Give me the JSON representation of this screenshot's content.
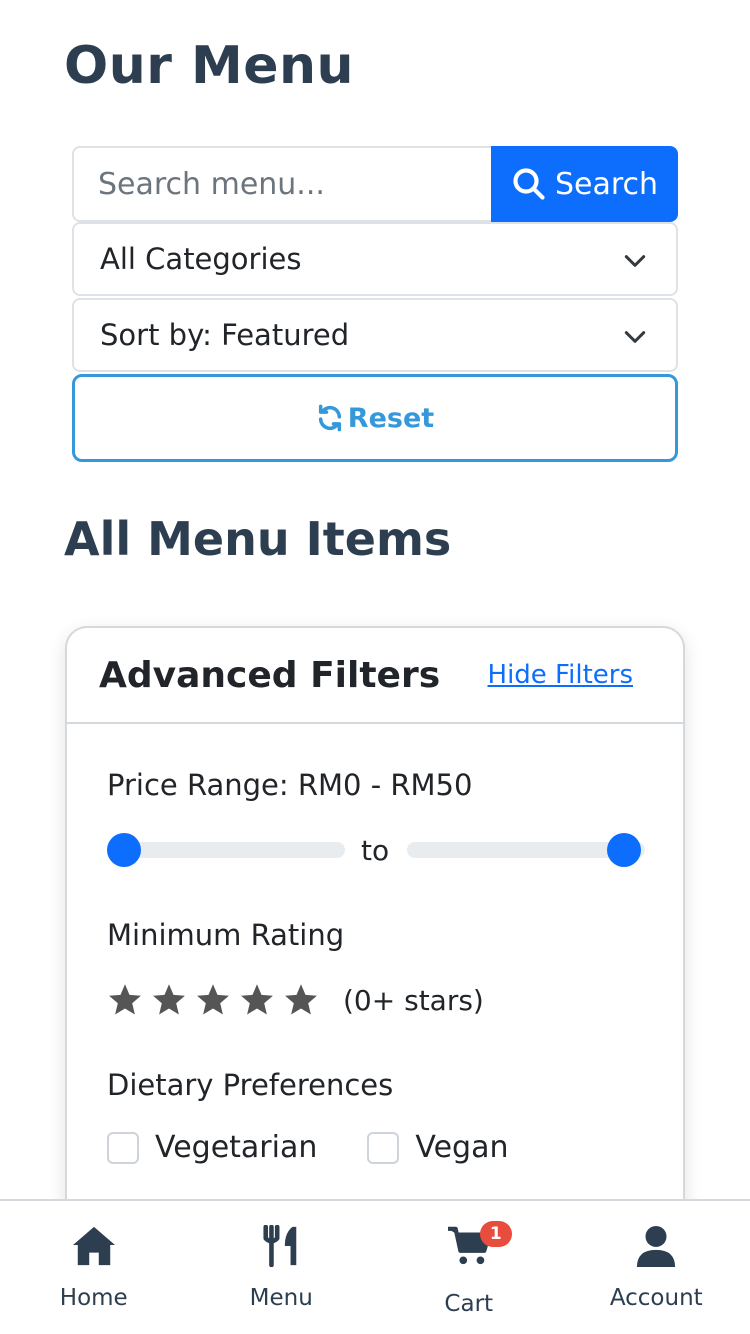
{
  "header": {
    "title": "Our Menu"
  },
  "search": {
    "placeholder": "Search menu...",
    "button_label": "Search"
  },
  "filters_bar": {
    "category_value": "All Categories",
    "sort_value": "Sort by: Featured",
    "reset_label": "Reset"
  },
  "section": {
    "title": "All Menu Items"
  },
  "advanced_filters": {
    "title": "Advanced Filters",
    "hide_label": "Hide Filters",
    "price_label": "Price Range: RM0 - RM50",
    "price_min": 0,
    "price_max": 50,
    "to_label": "to",
    "rating_label": "Minimum Rating",
    "rating_text": "(0+ stars)",
    "rating_value": 0,
    "dietary_label": "Dietary Preferences",
    "options": [
      {
        "label": "Vegetarian",
        "checked": false
      },
      {
        "label": "Vegan",
        "checked": false
      }
    ]
  },
  "bottom_nav": {
    "items": [
      {
        "label": "Home",
        "icon": "home-icon"
      },
      {
        "label": "Menu",
        "icon": "utensils-icon"
      },
      {
        "label": "Cart",
        "icon": "cart-icon",
        "badge": "1"
      },
      {
        "label": "Account",
        "icon": "user-icon"
      }
    ]
  },
  "colors": {
    "primary": "#0d6efd",
    "accent": "#3498db",
    "heading": "#2c3e50",
    "badge": "#e74c3c",
    "star": "#555555"
  }
}
